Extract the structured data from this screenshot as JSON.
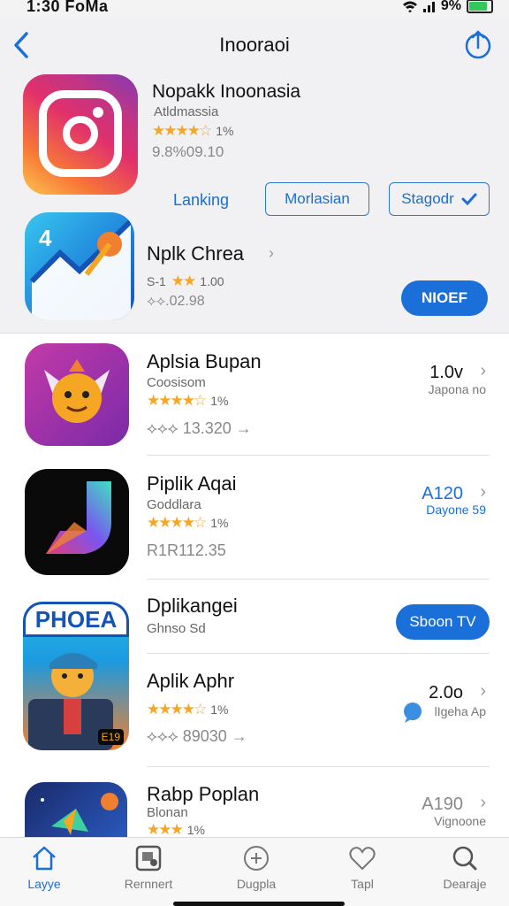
{
  "status": {
    "time": "1:30 FoMa",
    "battery": "9%"
  },
  "nav": {
    "title": "Inooraoi",
    "back_icon": "chevron-left-icon",
    "share_icon": "share-icon"
  },
  "featured": {
    "title": "Nopakk Inoonasia",
    "subtitle": "Atldmassia",
    "rating_text": "1%",
    "stars": "★★★★☆",
    "size": "9.8%09.10",
    "link_label": "Lanking",
    "button_1": "Morlasian",
    "button_2": "Stagodr"
  },
  "second": {
    "title": "Nplk Chrea",
    "rating_prefix": "S-1",
    "stars": "★★",
    "rating_text": "1.00",
    "size": "⟡⟡.02.98",
    "button": "NIOEF"
  },
  "apps": [
    {
      "title": "Aplsia Bupan",
      "sub": "Coosisom",
      "stars": "★★★★☆",
      "rating": "1%",
      "size": "⟡⟡⟡ 13.320 →",
      "right_val": "1.0v",
      "right_sub": "Japona no"
    },
    {
      "title": "Piplik Aqai",
      "sub": "Goddlara",
      "stars": "★★★★☆",
      "rating": "1%",
      "size": "R1R112.35",
      "right_val": "A120",
      "right_sub": "Dayone 59"
    },
    {
      "title": "Dplikangei",
      "sub": "Ghnso Sd",
      "button": "Sboon TV",
      "button_top": "⋅⋅ ⋅⋅"
    },
    {
      "title": "Aplik Aphr",
      "stars": "★★★★☆",
      "rating": "1%",
      "size": "⟡⟡⟡ 89030 →",
      "right_val": "2.0o",
      "right_sub": "lIgeha Ap",
      "badge": "E19"
    },
    {
      "title": "Rabp Poplan",
      "sub": "Blonan",
      "stars": "★★★",
      "rating": "1%",
      "right_val": "A190",
      "right_sub": "Vignoone"
    }
  ],
  "app5_banner": "PHOEA",
  "tabs": [
    {
      "label": "Layye",
      "icon": "home-icon"
    },
    {
      "label": "Rernnert",
      "icon": "apps-icon"
    },
    {
      "label": "Dugpla",
      "icon": "plus-icon"
    },
    {
      "label": "Tapl",
      "icon": "heart-icon"
    },
    {
      "label": "Dearaje",
      "icon": "search-icon"
    }
  ],
  "colors": {
    "accent": "#1a6fd8",
    "star": "#f5a623",
    "battery": "#34c759"
  }
}
